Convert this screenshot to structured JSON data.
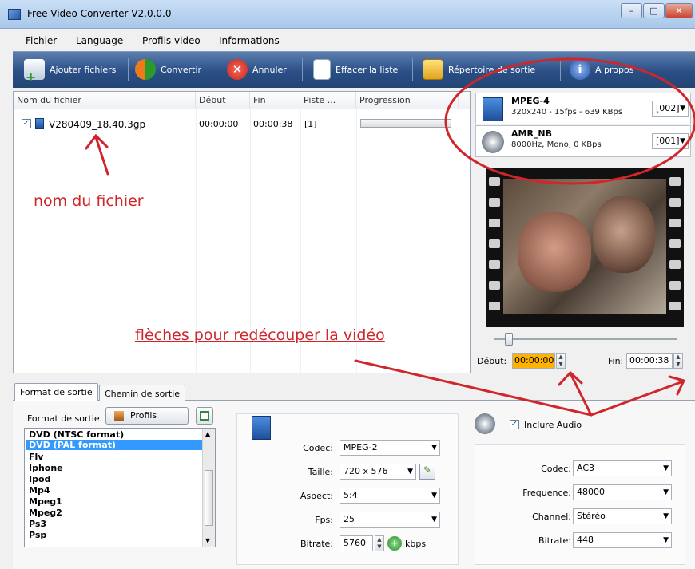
{
  "window": {
    "title": "Free Video Converter V2.0.0.0",
    "min": "–",
    "max": "□",
    "close": "✕"
  },
  "menu": [
    "Fichier",
    "Language",
    "Profils video",
    "Informations"
  ],
  "toolbar": {
    "add": "Ajouter fichiers",
    "convert": "Convertir",
    "cancel": "Annuler",
    "clear": "Effacer la liste",
    "output_dir": "Répertoire de sortie",
    "about": "A propos"
  },
  "files": {
    "headers": [
      "Nom du fichier",
      "Début",
      "Fin",
      "Piste ...",
      "Progression"
    ],
    "rows": [
      {
        "checked": true,
        "name": "V280409_18.40.3gp",
        "start": "00:00:00",
        "end": "00:00:38",
        "track": "[1]",
        "progress": 0
      }
    ]
  },
  "streams": [
    {
      "name": "MPEG-4",
      "desc": "320x240 - 15fps - 639 KBps",
      "id": "[002]",
      "icon": "video-stream-icon"
    },
    {
      "name": "AMR_NB",
      "desc": "8000Hz, Mono, 0 KBps",
      "id": "[001]",
      "icon": "audio-speaker-icon"
    }
  ],
  "trim": {
    "start_label": "Début:",
    "start": "00:00:00",
    "end_label": "Fin:",
    "end": "00:00:38"
  },
  "tabs": [
    "Format de sortie",
    "Chemin de sortie"
  ],
  "format": {
    "label": "Format de sortie:",
    "profils": "Profils",
    "list": [
      "DVD (NTSC format)",
      "DVD (PAL format)",
      "Flv",
      "Iphone",
      "Ipod",
      "Mp4",
      "Mpeg1",
      "Mpeg2",
      "Ps3",
      "Psp"
    ],
    "selected": "DVD (PAL format)"
  },
  "video": {
    "codec_label": "Codec:",
    "codec": "MPEG-2",
    "size_label": "Taille:",
    "size": "720 x 576",
    "aspect_label": "Aspect:",
    "aspect": "5:4",
    "fps_label": "Fps:",
    "fps": "25",
    "bitrate_label": "Bitrate:",
    "bitrate": "5760",
    "unit": "kbps"
  },
  "audio": {
    "include_label": "Inclure Audio",
    "include": true,
    "codec_label": "Codec:",
    "codec": "AC3",
    "freq_label": "Frequence:",
    "freq": "48000",
    "channel_label": "Channel:",
    "channel": "Stéréo",
    "bitrate_label": "Bitrate:",
    "bitrate": "448"
  },
  "annotations": {
    "file_name": "nom du fichier",
    "trim_arrows": "flèches pour redécouper la vidéo"
  },
  "colors": {
    "toolbar": "#2a4f86",
    "selection": "#3399ff",
    "annotation": "#d0262b",
    "highlight": "#ffb300"
  }
}
